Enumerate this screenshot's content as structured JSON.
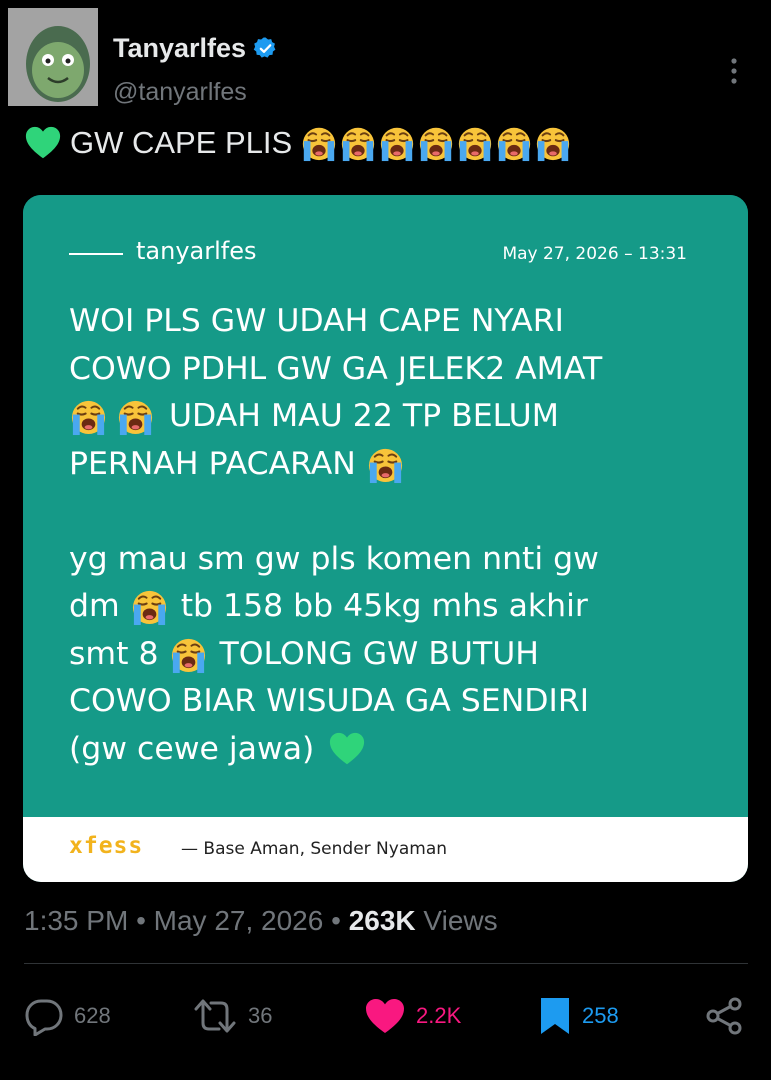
{
  "author": {
    "display_name": "Tanyarlfes",
    "handle": "@tanyarlfes",
    "verified": true
  },
  "tweet": {
    "text": "GW CAPE PLIS",
    "leading_emoji": "green-heart",
    "trailing_emoji": "loudly-crying-face",
    "trailing_emoji_count": 7
  },
  "media_card": {
    "author": "tanyarlfes",
    "date": "May 27, 2026 – 13:31",
    "paragraph1": [
      {
        "text": "WOI PLS GW UDAH CAPE NYARI"
      },
      {
        "text": "COWO PDHL GW GA JELEK2 AMAT"
      },
      {
        "text": "UDAH MAU 22 TP BELUM",
        "emoji_before": [
          "loudly-crying-face",
          "loudly-crying-face"
        ]
      },
      {
        "text": "PERNAH PACARAN",
        "emoji_after": [
          "loudly-crying-face"
        ]
      }
    ],
    "paragraph2": [
      {
        "text": "yg mau sm gw pls komen nnti gw"
      },
      {
        "pre": "dm",
        "text": "tb 158 bb 45kg mhs akhir",
        "emoji_mid": "loudly-crying-face"
      },
      {
        "pre": "smt 8",
        "text": "TOLONG GW BUTUH",
        "emoji_mid": "loudly-crying-face"
      },
      {
        "text": "COWO BIAR WISUDA GA SENDIRI"
      },
      {
        "text": "(gw cewe jawa)",
        "emoji_after": [
          "green-heart"
        ]
      }
    ],
    "brand": "xfess",
    "tagline": "— Base Aman, Sender Nyaman",
    "colors": {
      "card": "#159a88",
      "brand": "#f2b31d"
    }
  },
  "meta": {
    "time": "1:35 PM",
    "date": "May 27, 2026",
    "views_count": "263K",
    "views_label": "Views",
    "separator": "•"
  },
  "actions": {
    "replies": "628",
    "reposts": "36",
    "likes": "2.2K",
    "bookmarks": "258",
    "like_color": "#f91880",
    "bookmark_color": "#1d9bf0"
  },
  "icons": [
    "avatar",
    "verified-badge-icon",
    "more-icon",
    "reply-icon",
    "repost-icon",
    "heart-icon",
    "bookmark-icon",
    "share-icon"
  ]
}
